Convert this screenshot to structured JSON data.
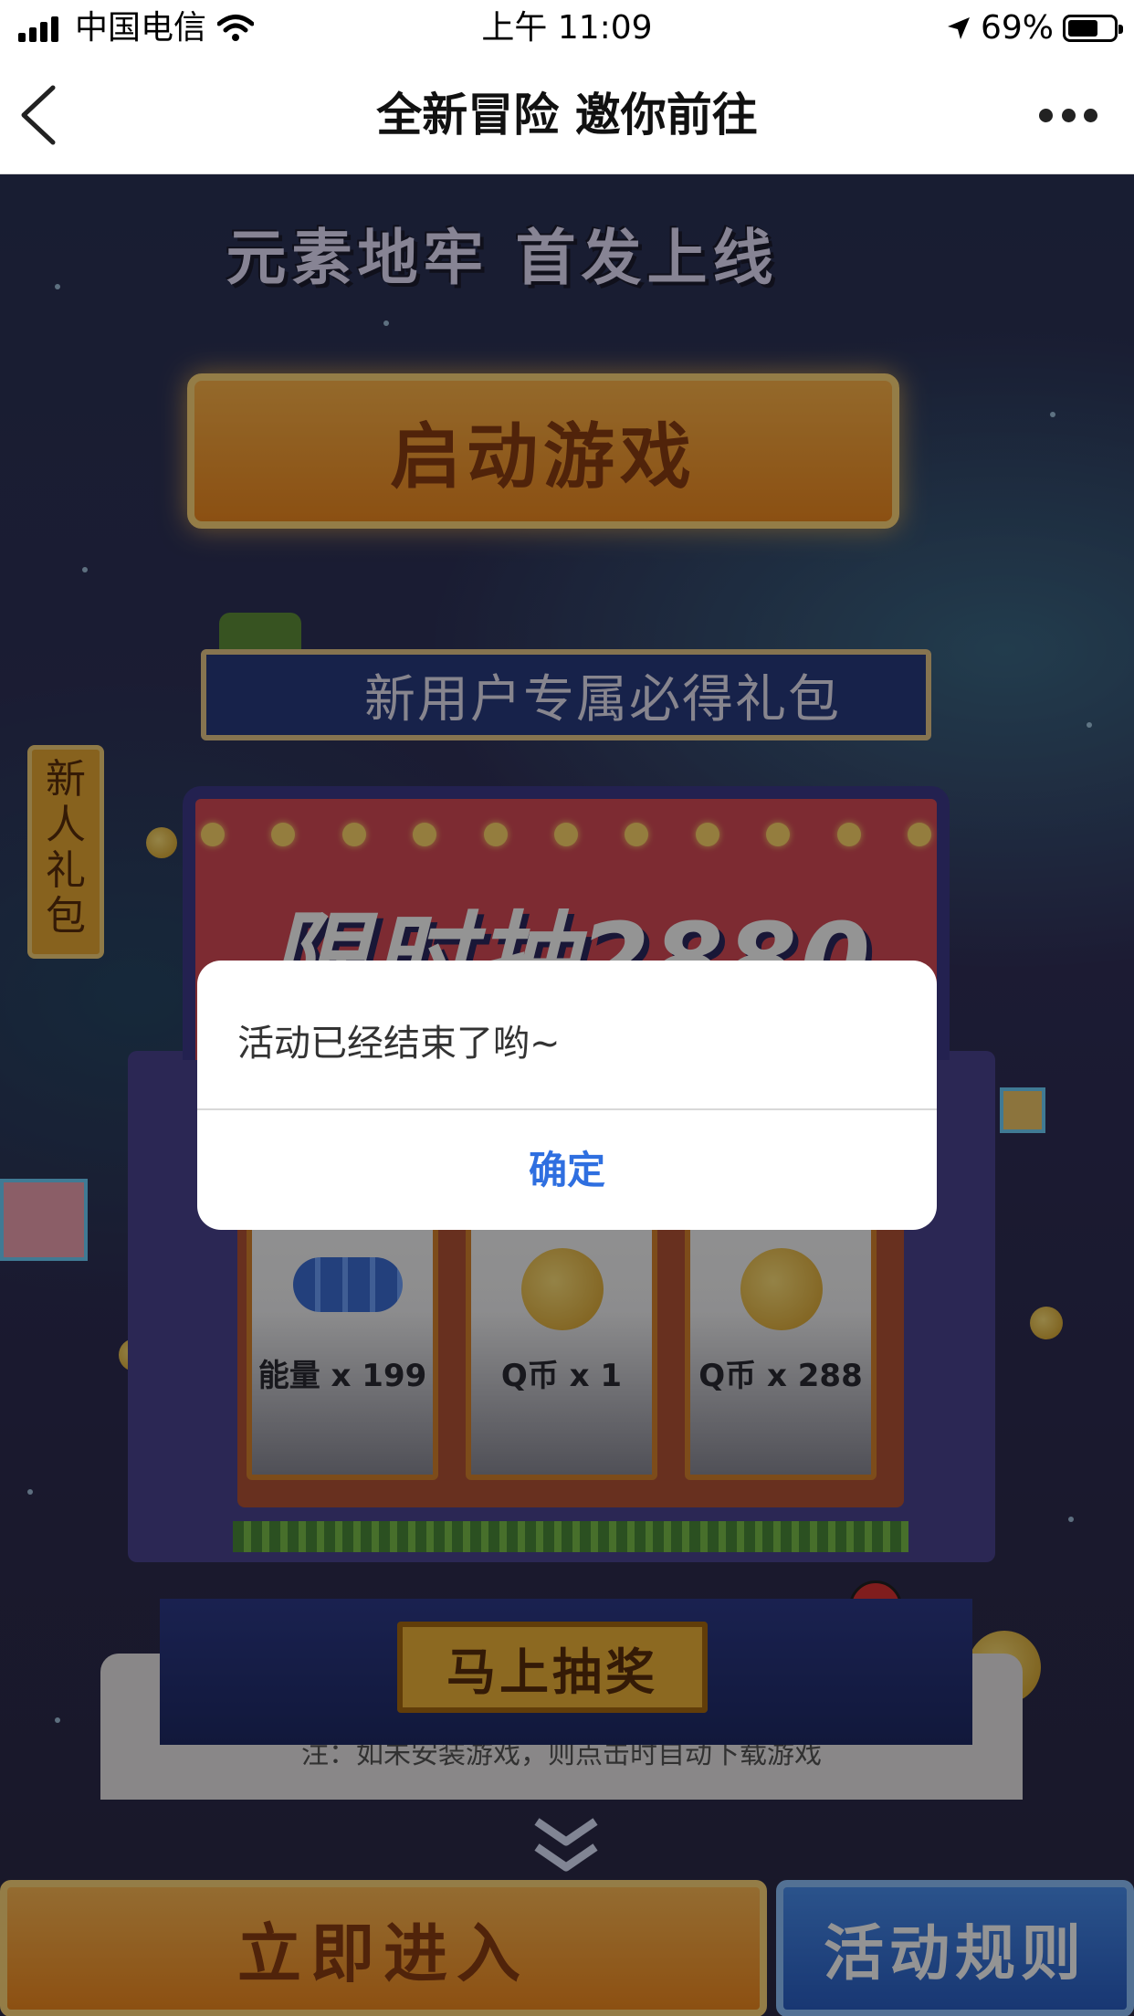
{
  "status_bar": {
    "carrier": "中国电信",
    "time": "上午 11:09",
    "battery": "69%"
  },
  "nav": {
    "title": "全新冒险 邀你前往"
  },
  "page": {
    "banner_title": "元素地牢 首发上线",
    "start_button": "启动游戏",
    "gift_banner": "新用户专属必得礼包",
    "side_tag": "新人礼包",
    "slot_headline": "限时抽2880币",
    "reels": [
      {
        "label": "能量 x 199",
        "icon": "energy-gems-icon"
      },
      {
        "label": "Q币 x 1",
        "icon": "coin-icon"
      },
      {
        "label": "Q币 x 288",
        "icon": "coin-pile-icon"
      }
    ],
    "note": "注：如未安装游戏，则点击时自动下载游戏",
    "draw_button": "马上抽奖",
    "enter_button": "立即进入",
    "rules_button": "活动规则"
  },
  "dialog": {
    "message": "活动已经结束了哟~",
    "confirm": "确定"
  },
  "colors": {
    "dialog_confirm": "#2f6fe0",
    "start_button": "#f08a20",
    "rules_button": "#2a5fc6"
  }
}
